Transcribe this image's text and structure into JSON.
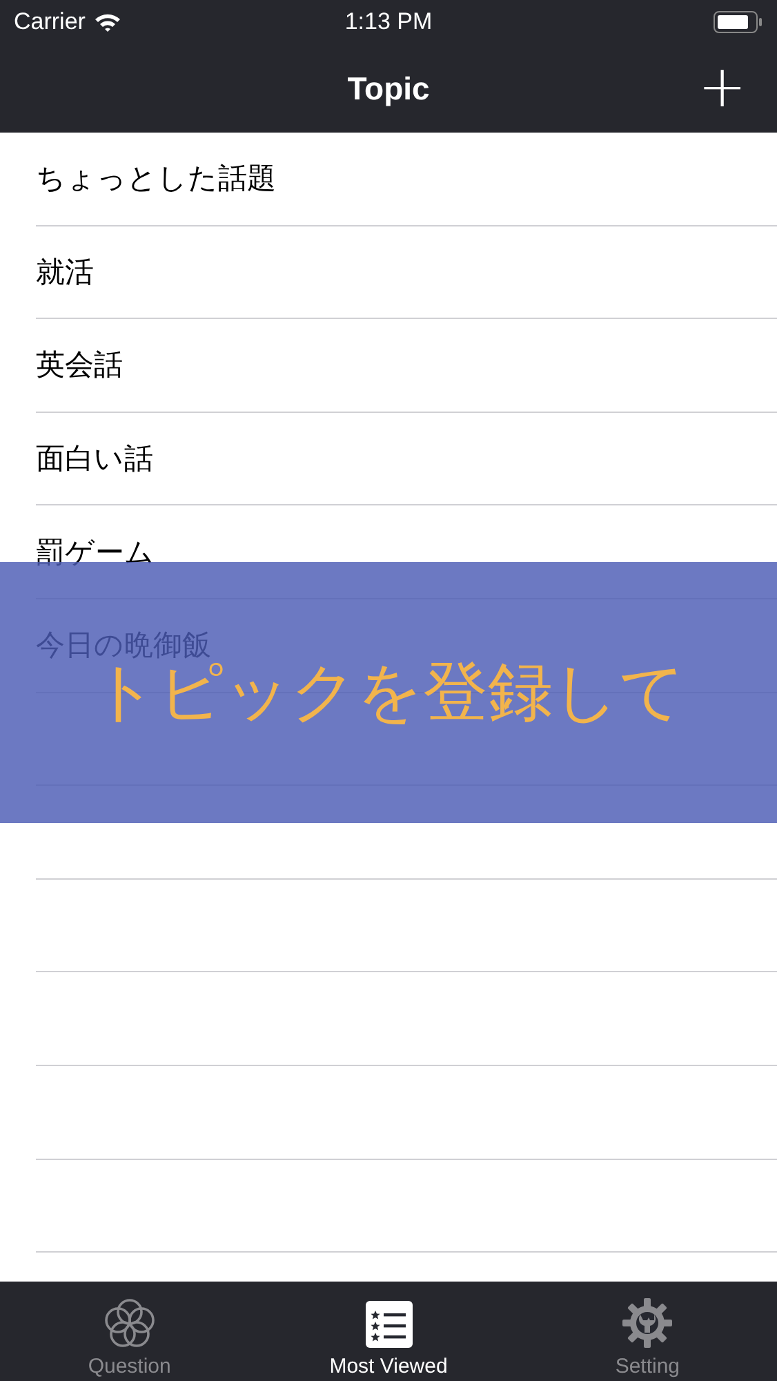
{
  "status_bar": {
    "carrier": "Carrier",
    "time": "1:13 PM"
  },
  "nav_bar": {
    "title": "Topic",
    "add_button": "+"
  },
  "topics": [
    {
      "label": "ちょっとした話題"
    },
    {
      "label": "就活"
    },
    {
      "label": "英会話"
    },
    {
      "label": "面白い話"
    },
    {
      "label": "罰ゲーム"
    },
    {
      "label": "今日の晩御飯"
    }
  ],
  "banner": {
    "text": "トピックを登録して"
  },
  "tab_bar": [
    {
      "kind": "circles",
      "label": "Question",
      "selected": false
    },
    {
      "kind": "list",
      "label": "Most Viewed",
      "selected": true
    },
    {
      "kind": "gear",
      "label": "Setting",
      "selected": false
    }
  ]
}
